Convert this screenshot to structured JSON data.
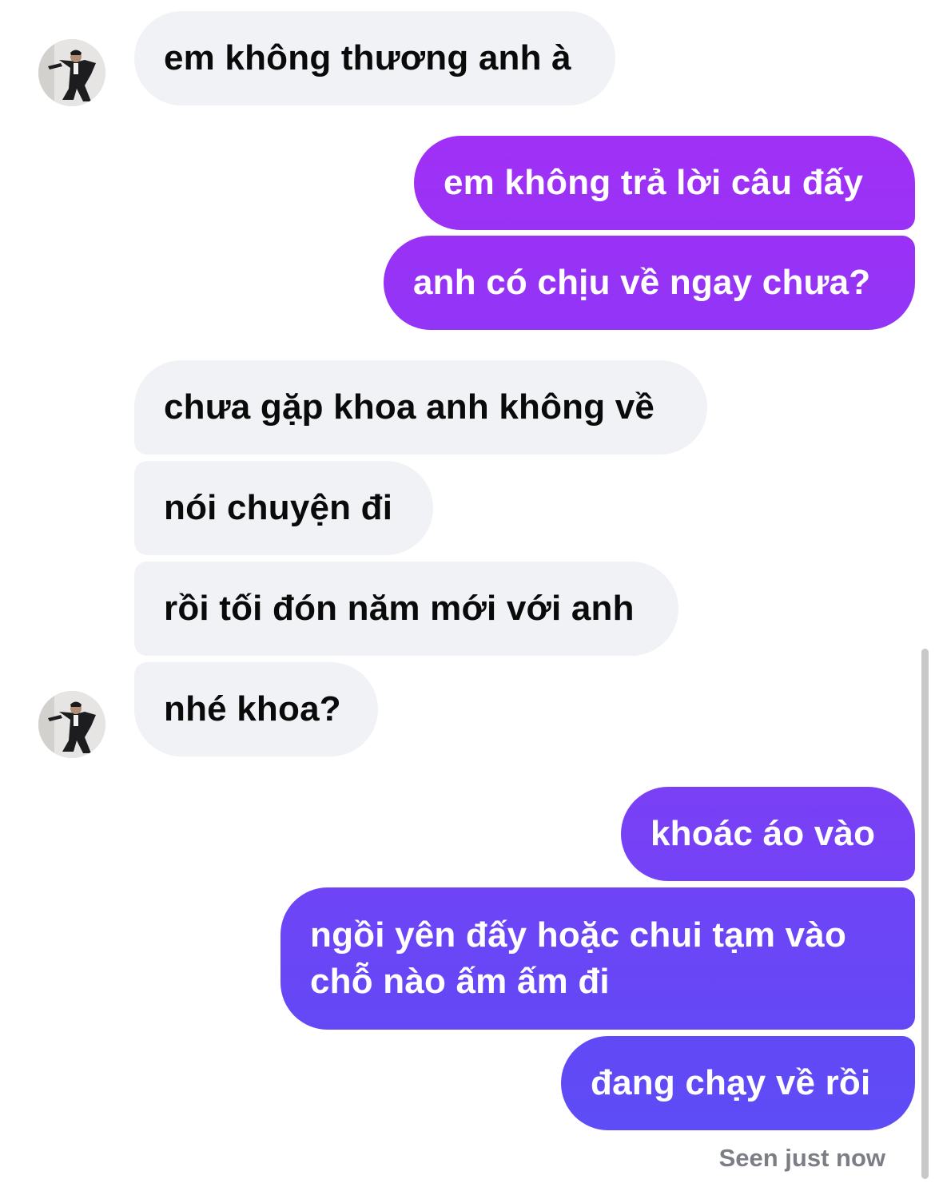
{
  "messages": {
    "m1": "em không thương anh à",
    "m2": "em không trả lời câu đấy",
    "m3": "anh có chịu về ngay chưa?",
    "m4": "chưa gặp khoa anh không về",
    "m5": "nói chuyện đi",
    "m6": "rồi tối đón năm mới với anh",
    "m7": "nhé khoa?",
    "m8": "khoác áo vào",
    "m9_line1": "ngồi yên đấy hoặc chui tạm vào",
    "m9_line2": "chỗ nào ấm ấm đi",
    "m10": "đang chạy về rồi"
  },
  "status": {
    "seen": "Seen just now"
  },
  "colors": {
    "incoming_bubble": "#f0f2f5",
    "outgoing_top": "#9b30f5",
    "outgoing_bottom": "#5f4cf6"
  },
  "icons": {
    "avatar": "contact-avatar-photo"
  }
}
